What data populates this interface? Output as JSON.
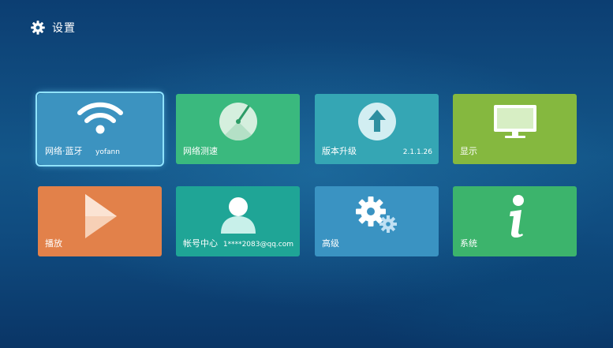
{
  "header": {
    "title": "设置",
    "icon": "gear-icon"
  },
  "tiles": [
    {
      "label": "网络·蓝牙",
      "sub": "yofann",
      "icon": "wifi-icon",
      "color": "#3c93c0",
      "selected": true
    },
    {
      "label": "网络测速",
      "sub": "",
      "icon": "speedometer-icon",
      "color": "#3ab97e"
    },
    {
      "label": "版本升级",
      "sub": "2.1.1.26",
      "icon": "upgrade-arrow-icon",
      "color": "#35a6b4"
    },
    {
      "label": "显示",
      "sub": "",
      "icon": "monitor-icon",
      "color": "#85b83f"
    },
    {
      "label": "播放",
      "sub": "",
      "icon": "play-icon",
      "color": "#e2814a"
    },
    {
      "label": "帐号中心",
      "sub": "1****2083@qq.com",
      "icon": "user-icon",
      "color": "#1fa596"
    },
    {
      "label": "高级",
      "sub": "",
      "icon": "gears-icon",
      "color": "#3a93c2"
    },
    {
      "label": "系统",
      "sub": "",
      "icon": "info-icon",
      "color": "#3cb46c"
    }
  ]
}
